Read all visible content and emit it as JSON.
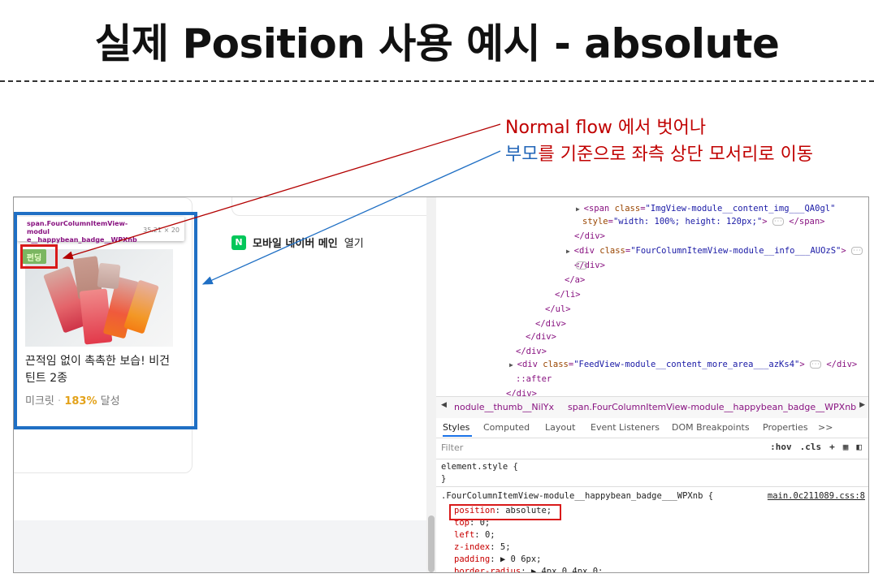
{
  "slide": {
    "title": "실제 Position 사용 예시 - absolute",
    "note_line1": "Normal flow 에서 벗어나",
    "note_line2_highlight": "부모",
    "note_line2_rest": "를 기준으로 좌측 상단 모서리로 이동"
  },
  "page": {
    "tooltip_name": "span.FourColumnItemView-module__happybean_badge__WPXnb",
    "tooltip_name_line1": "span.FourColumnItemView-modul",
    "tooltip_name_line2": "e__happybean_badge__WPXnb",
    "tooltip_dim": "35.21 × 20",
    "badge": "펀딩",
    "product_title": "끈적임 없이 촉촉한 보습! 비건 틴트 2종",
    "product_seller": "미크릿",
    "product_sep": "·",
    "product_pct": "183%",
    "product_status": "달성",
    "naver_icon": "N",
    "naver_bold": "모바일 네이버 메인",
    "naver_rest": "열기"
  },
  "devtools": {
    "dom_lines": [
      {
        "indent": 0,
        "tri": "▶",
        "text": "<span class=\"ImgView-module__content_img___QA0gl\""
      },
      {
        "indent": 1,
        "tri": "",
        "text": "style=\"width: 100%; height: 120px;\">"
      },
      {
        "indent": 2,
        "tri": "",
        "text": "</div>"
      },
      {
        "indent": 3,
        "tri": "▶",
        "text": "<div class=\"FourColumnItemView-module__info___AUOzS\">"
      },
      {
        "indent": 4,
        "tri": "",
        "text": "</div>"
      },
      {
        "indent": 5,
        "tri": "",
        "text": "</a>"
      },
      {
        "indent": 6,
        "tri": "",
        "text": "</li>"
      },
      {
        "indent": 7,
        "tri": "",
        "text": "</ul>"
      },
      {
        "indent": 8,
        "tri": "",
        "text": "</div>"
      },
      {
        "indent": 9,
        "tri": "",
        "text": "</div>"
      },
      {
        "indent": 10,
        "tri": "",
        "text": "</div>"
      },
      {
        "indent": 11,
        "tri": "▶",
        "text": "<div class=\"FeedView-module__content_more_area___azKs4\">"
      },
      {
        "indent": 12,
        "tri": "",
        "text": "::after"
      },
      {
        "indent": 13,
        "tri": "",
        "text": "</div>"
      }
    ],
    "crumb_prev": "nodule__thumb__NilYx",
    "crumb_current": "span.FourColumnItemView-module__happybean_badge__WPXnb",
    "tabs": [
      "Styles",
      "Computed",
      "Layout",
      "Event Listeners",
      "DOM Breakpoints",
      "Properties",
      ">>"
    ],
    "filter_placeholder": "Filter",
    "filter_hov": ":hov",
    "filter_cls": ".cls",
    "filter_plus": "+",
    "element_style_open": "element.style {",
    "element_style_close": "}",
    "selector": ".FourColumnItemView-module__happybean_badge___WPXnb {",
    "source": "main.0c211089.css:8",
    "props": [
      {
        "name": "position",
        "value": "absolute;"
      },
      {
        "name": "top",
        "value": "0;"
      },
      {
        "name": "left",
        "value": "0;"
      },
      {
        "name": "z-index",
        "value": "5;"
      },
      {
        "name": "padding",
        "value": "▶ 0 6px;"
      },
      {
        "name": "border-radius",
        "value": "▶ 4px 0 4px 0;"
      }
    ],
    "dom_tail_close": "</span>",
    "dom_tail_close2": "</div>"
  }
}
